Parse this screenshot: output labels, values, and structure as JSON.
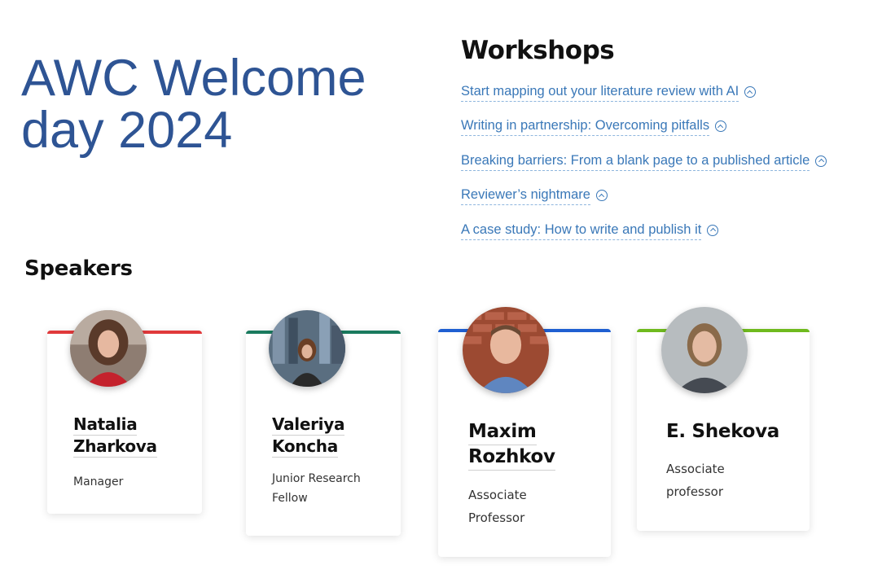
{
  "title": {
    "line1": "AWC Welcome",
    "line2": "day 2024"
  },
  "workshops": {
    "heading": "Workshops",
    "items": [
      {
        "label": "Start mapping out your literature review with AI",
        "icon": "chevron-up-circle-icon"
      },
      {
        "label": "Writing in partnership: Overcoming pitfalls",
        "icon": "chevron-up-circle-icon"
      },
      {
        "label": "Breaking barriers: From a blank page to a published article",
        "icon": "chevron-up-circle-icon"
      },
      {
        "label": "Reviewer’s nightmare",
        "icon": "chevron-up-circle-icon"
      },
      {
        "label": "A case study: How to write and publish it",
        "icon": "chevron-up-circle-icon"
      }
    ]
  },
  "speakers": {
    "heading": "Speakers",
    "cards": [
      {
        "first": "Natalia",
        "last": "Zharkova",
        "role_line1": "Manager",
        "role_line2": "",
        "accent": "#e0393b"
      },
      {
        "first": "Valeriya",
        "last": "Koncha",
        "role_line1": "Junior Research",
        "role_line2": "Fellow",
        "accent": "#1a7a5e"
      },
      {
        "first": "Maxim",
        "last": "Rozhkov",
        "role_line1": "Associate",
        "role_line2": "Professor",
        "accent": "#1f5fd1"
      },
      {
        "first": "E. Shekova",
        "last": "",
        "role_line1": "Associate",
        "role_line2": "professor",
        "accent": "#6fba1e"
      }
    ]
  }
}
